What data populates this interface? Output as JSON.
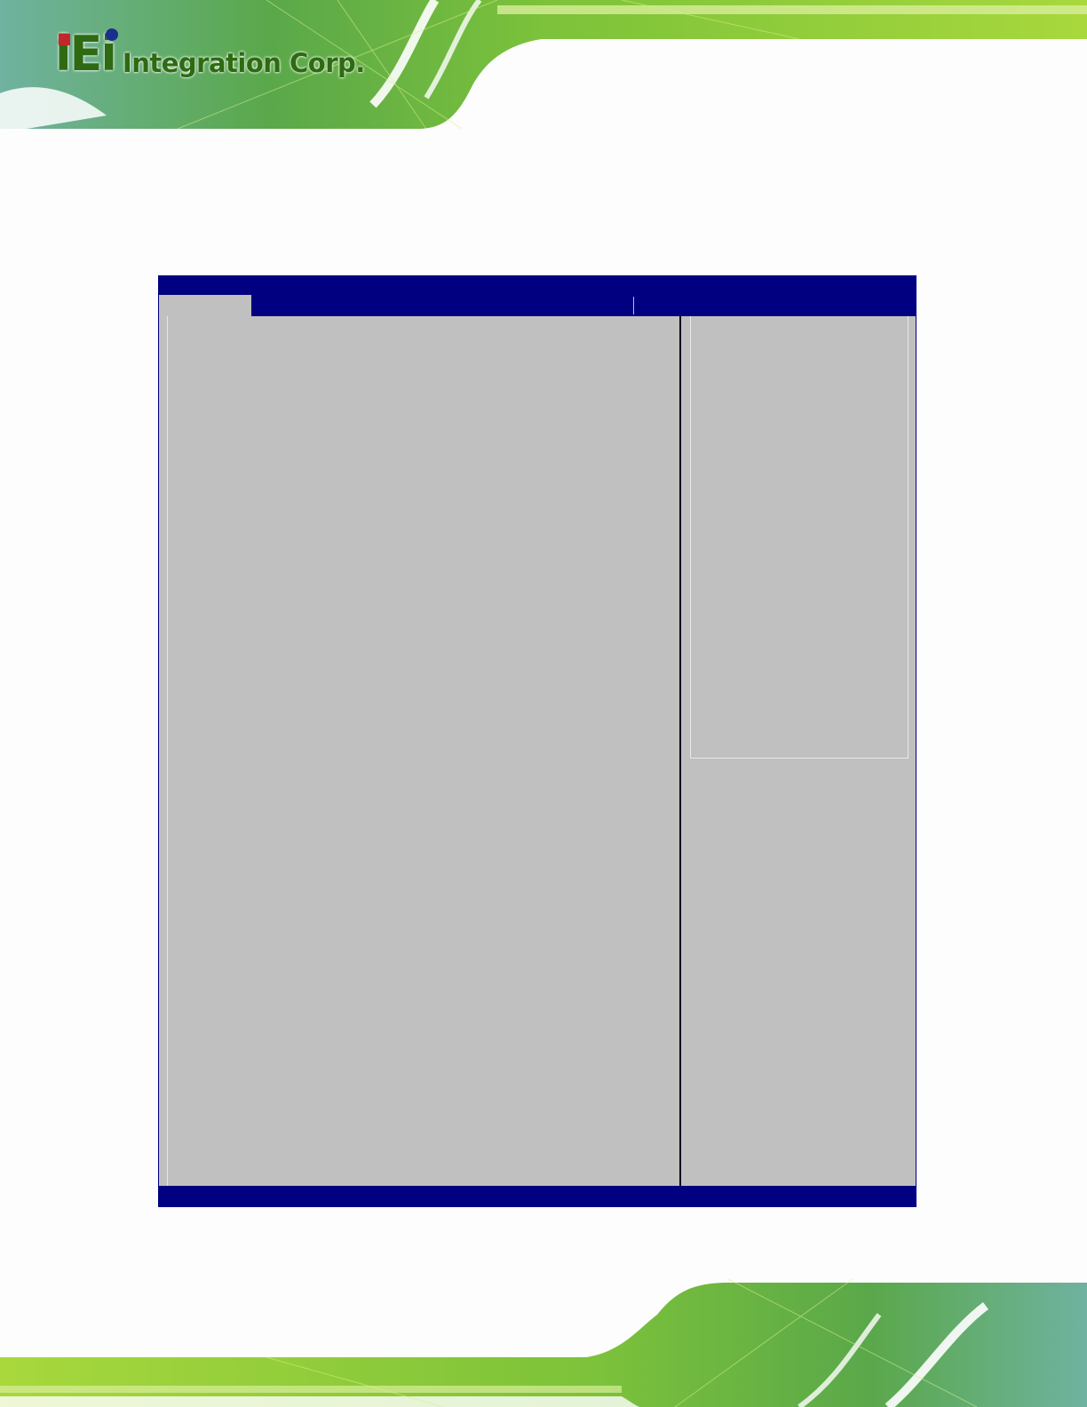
{
  "header": {
    "logo_mark": "iEi",
    "logo_text": "Integration Corp."
  },
  "bios": {
    "title": "",
    "active_tab": "",
    "status_bar": "",
    "colors": {
      "frame": "#000080",
      "panel": "#c0c0c0",
      "brand_green": "#2e6a12"
    }
  }
}
